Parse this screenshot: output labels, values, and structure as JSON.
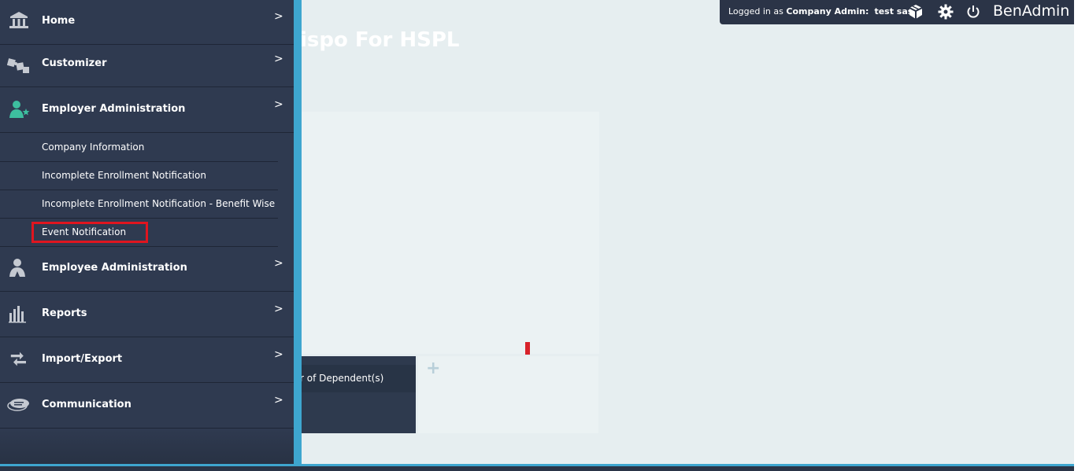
{
  "page": {
    "title": "ispo For HSPL"
  },
  "topbar": {
    "logged_in_prefix": "Logged in as ",
    "role": "Company Admin:",
    "user": "test sas",
    "brand": "BenAdmin",
    "icons": [
      "box-icon",
      "gear-icon",
      "power-icon"
    ]
  },
  "sidebar": {
    "items": [
      {
        "label": "Home",
        "icon": "bank-icon"
      },
      {
        "label": "Customizer",
        "icon": "puzzle-icon"
      },
      {
        "label": "Employer Administration",
        "icon": "employer-star-icon"
      },
      {
        "label": "Employee Administration",
        "icon": "person-icon"
      },
      {
        "label": "Reports",
        "icon": "bar-chart-icon"
      },
      {
        "label": "Import/Export",
        "icon": "arrows-icon"
      },
      {
        "label": "Communication",
        "icon": "chat-icon"
      }
    ],
    "submenu": [
      {
        "label": "Company Information"
      },
      {
        "label": "Incomplete Enrollment Notification"
      },
      {
        "label": "Incomplete Enrollment Notification - Benefit Wise"
      },
      {
        "label": "Event Notification"
      }
    ],
    "chevron": ">"
  },
  "tiles": {
    "dark_header": "r of Dependent(s)",
    "plus": "+"
  },
  "colors": {
    "sidebar_bg": "#2f3a50",
    "accent": "#3ea6cf",
    "highlight": "#e0151f",
    "icon_teal": "#3dbf9f"
  }
}
